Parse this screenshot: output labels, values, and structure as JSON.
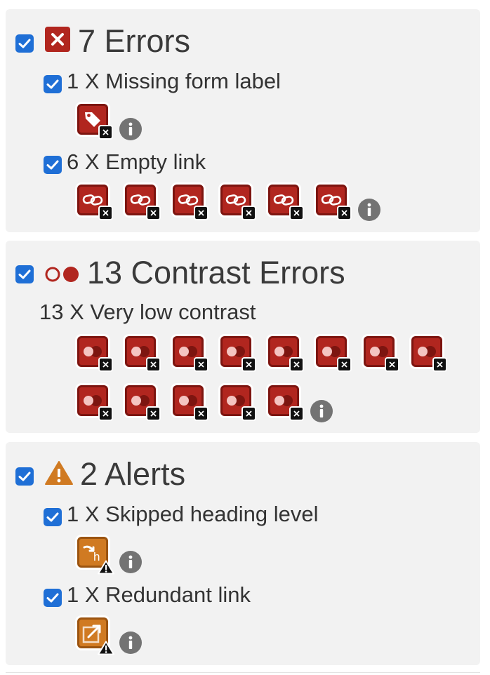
{
  "errors": {
    "title": "7 Errors",
    "items": [
      {
        "label": "1 X Missing form label",
        "count": 1
      },
      {
        "label": "6 X Empty link",
        "count": 6
      }
    ]
  },
  "contrast": {
    "title": "13 Contrast Errors",
    "items": [
      {
        "label": "13 X Very low contrast",
        "count": 13
      }
    ]
  },
  "alerts": {
    "title": "2 Alerts",
    "items": [
      {
        "label": "1 X Skipped heading level",
        "count": 1
      },
      {
        "label": "1 X Redundant link",
        "count": 1
      }
    ]
  },
  "colors": {
    "error_red": "#b1261f",
    "alert_orange": "#d07a22",
    "checkbox_blue": "#1f6fd6",
    "panel_bg": "#f2f2f2",
    "info_gray": "#737373"
  },
  "icons": {
    "errors_header": "error-x-icon",
    "contrast_header": "contrast-circles-icon",
    "alerts_header": "warning-triangle-icon",
    "missing_form_label": "tag-icon",
    "empty_link": "chain-link-icon",
    "very_low_contrast": "contrast-icon",
    "skipped_heading": "heading-arrow-icon",
    "redundant_link": "redundant-link-icon",
    "info": "info-icon"
  }
}
